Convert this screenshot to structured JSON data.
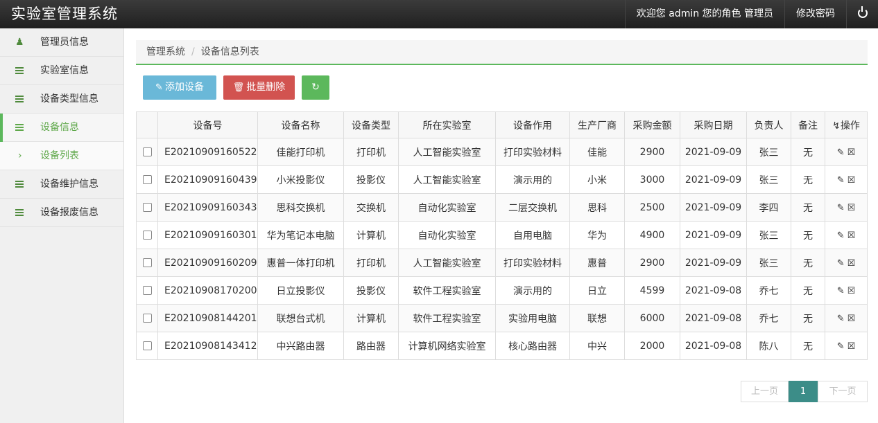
{
  "header": {
    "title": "实验室管理系统",
    "welcome": "欢迎您 admin 您的角色 管理员",
    "change_password": "修改密码",
    "power_icon": "power-icon"
  },
  "sidebar": {
    "items": [
      {
        "label": "管理员信息",
        "icon": "user-icon"
      },
      {
        "label": "实验室信息",
        "icon": "bars-icon"
      },
      {
        "label": "设备类型信息",
        "icon": "bars-icon"
      },
      {
        "label": "设备信息",
        "icon": "bars-icon"
      },
      {
        "label": "设备列表",
        "icon": "chevron-right-icon"
      },
      {
        "label": "设备维护信息",
        "icon": "bars-icon"
      },
      {
        "label": "设备报废信息",
        "icon": "bars-icon"
      }
    ],
    "accent": "#5cb85c"
  },
  "breadcrumb": {
    "root": "管理系统",
    "current": "设备信息列表"
  },
  "toolbar": {
    "add_label": "添加设备",
    "delete_label": "批量删除"
  },
  "table": {
    "headers": [
      "设备号",
      "设备名称",
      "设备类型",
      "所在实验室",
      "设备作用",
      "生产厂商",
      "采购金额",
      "采购日期",
      "负责人",
      "备注",
      "操作"
    ],
    "rows": [
      [
        "E20210909160522",
        "佳能打印机",
        "打印机",
        "人工智能实验室",
        "打印实验材料",
        "佳能",
        "2900",
        "2021-09-09",
        "张三",
        "无"
      ],
      [
        "E20210909160439",
        "小米投影仪",
        "投影仪",
        "人工智能实验室",
        "演示用的",
        "小米",
        "3000",
        "2021-09-09",
        "张三",
        "无"
      ],
      [
        "E20210909160343",
        "思科交换机",
        "交换机",
        "自动化实验室",
        "二层交换机",
        "思科",
        "2500",
        "2021-09-09",
        "李四",
        "无"
      ],
      [
        "E20210909160301",
        "华为笔记本电脑",
        "计算机",
        "自动化实验室",
        "自用电脑",
        "华为",
        "4900",
        "2021-09-09",
        "张三",
        "无"
      ],
      [
        "E20210909160209",
        "惠普一体打印机",
        "打印机",
        "人工智能实验室",
        "打印实验材料",
        "惠普",
        "2900",
        "2021-09-09",
        "张三",
        "无"
      ],
      [
        "E20210908170200",
        "日立投影仪",
        "投影仪",
        "软件工程实验室",
        "演示用的",
        "日立",
        "4599",
        "2021-09-08",
        "乔七",
        "无"
      ],
      [
        "E20210908144201",
        "联想台式机",
        "计算机",
        "软件工程实验室",
        "实验用电脑",
        "联想",
        "6000",
        "2021-09-08",
        "乔七",
        "无"
      ],
      [
        "E20210908143412",
        "中兴路由器",
        "路由器",
        "计算机网络实验室",
        "核心路由器",
        "中兴",
        "2000",
        "2021-09-08",
        "陈八",
        "无"
      ]
    ]
  },
  "pagination": {
    "prev": "上一页",
    "current": "1",
    "next": "下一页"
  }
}
